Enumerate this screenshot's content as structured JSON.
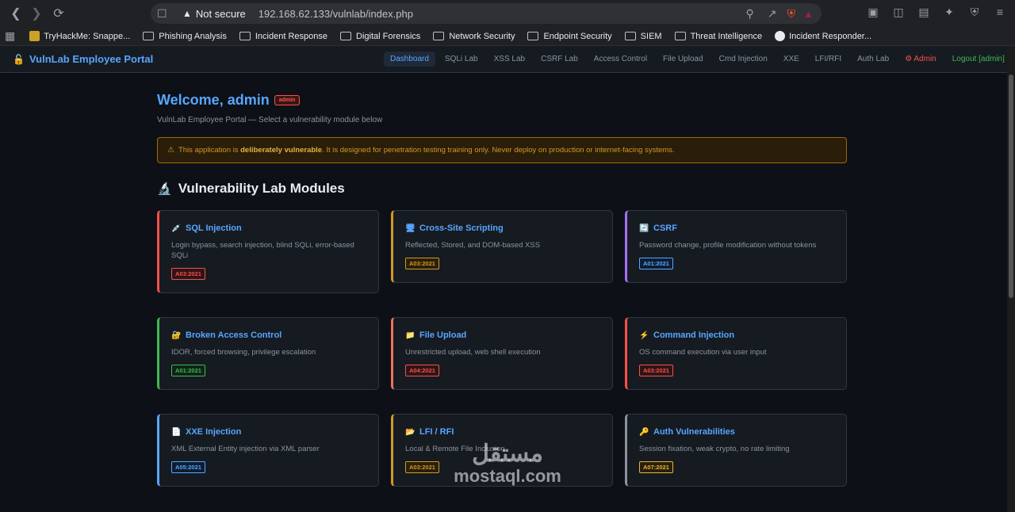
{
  "browser": {
    "security_label": "Not secure",
    "url": "192.168.62.133/vulnlab/index.php",
    "bookmarks": [
      {
        "label": "TryHackMe: Snappe...",
        "type": "favicon"
      },
      {
        "label": "Phishing Analysis",
        "type": "folder"
      },
      {
        "label": "Incident Response",
        "type": "folder"
      },
      {
        "label": "Digital Forensics",
        "type": "folder"
      },
      {
        "label": "Network Security",
        "type": "folder"
      },
      {
        "label": "Endpoint Security",
        "type": "folder"
      },
      {
        "label": "SIEM",
        "type": "folder"
      },
      {
        "label": "Threat Intelligence",
        "type": "folder"
      },
      {
        "label": "Incident Responder...",
        "type": "favicon"
      }
    ]
  },
  "app": {
    "brand": "VulnLab Employee Portal",
    "nav": [
      {
        "label": "Dashboard",
        "active": true
      },
      {
        "label": "SQLi Lab"
      },
      {
        "label": "XSS Lab"
      },
      {
        "label": "CSRF Lab"
      },
      {
        "label": "Access Control"
      },
      {
        "label": "File Upload"
      },
      {
        "label": "Cmd Injection"
      },
      {
        "label": "XXE"
      },
      {
        "label": "LFI/RFI"
      },
      {
        "label": "Auth Lab"
      },
      {
        "label": "⚙ Admin",
        "variant": "admin"
      },
      {
        "label": "Logout [admin]",
        "variant": "logout"
      }
    ]
  },
  "main": {
    "welcome": "Welcome, admin",
    "role_badge": "admin",
    "subtitle": "VulnLab Employee Portal — Select a vulnerability module below",
    "alert_prefix": "This application is ",
    "alert_bold": "deliberately vulnerable",
    "alert_suffix": ". It is designed for penetration testing training only. Never deploy on production or internet-facing systems.",
    "section_title": "Vulnerability Lab Modules"
  },
  "modules": [
    {
      "title": "SQL Injection",
      "icon": "syringe-icon",
      "glyph": "💉",
      "desc": "Login bypass, search injection, blind SQLi, error-based SQLi",
      "tag": "A03:2021",
      "color": "#f85149",
      "tag_class": "tag-red"
    },
    {
      "title": "Cross-Site Scripting",
      "icon": "monitor-icon",
      "glyph": "🖥",
      "desc": "Reflected, Stored, and DOM-based XSS",
      "tag": "A03:2021",
      "color": "#d29922",
      "tag_class": "tag-orange"
    },
    {
      "title": "CSRF",
      "icon": "refresh-icon",
      "glyph": "🔄",
      "desc": "Password change, profile modification without tokens",
      "tag": "A01:2021",
      "color": "#a371f7",
      "tag_class": "tag-blue"
    },
    {
      "title": "Broken Access Control",
      "icon": "lock-icon",
      "glyph": "🔐",
      "desc": "IDOR, forced browsing, privilege escalation",
      "tag": "A01:2021",
      "color": "#3fb950",
      "tag_class": "tag-green"
    },
    {
      "title": "File Upload",
      "icon": "folder-icon",
      "glyph": "📁",
      "desc": "Unrestricted upload, web shell execution",
      "tag": "A04:2021",
      "color": "#f0715a",
      "tag_class": "tag-red"
    },
    {
      "title": "Command Injection",
      "icon": "lightning-icon",
      "glyph": "⚡",
      "desc": "OS command execution via user input",
      "tag": "A03:2021",
      "color": "#f85149",
      "tag_class": "tag-red"
    },
    {
      "title": "XXE Injection",
      "icon": "document-icon",
      "glyph": "📄",
      "desc": "XML External Entity injection via XML parser",
      "tag": "A05:2021",
      "color": "#58a6ff",
      "tag_class": "tag-blue"
    },
    {
      "title": "LFI / RFI",
      "icon": "open-folder-icon",
      "glyph": "📂",
      "desc": "Local & Remote File Inclusion",
      "tag": "A03:2021",
      "color": "#d29922",
      "tag_class": "tag-orange"
    },
    {
      "title": "Auth Vulnerabilities",
      "icon": "key-icon",
      "glyph": "🔑",
      "desc": "Session fixation, weak crypto, no rate limiting",
      "tag": "A07:2021",
      "color": "#8b949e",
      "tag_class": "tag-yellow"
    }
  ],
  "watermark": {
    "arabic": "مستقل",
    "latin": "mostaql.com"
  }
}
